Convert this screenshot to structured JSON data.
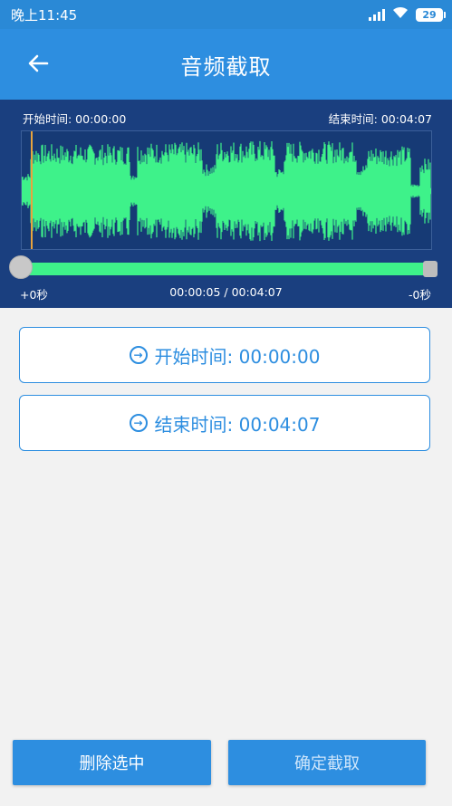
{
  "status_bar": {
    "time": "晚上11:45",
    "battery": "29",
    "icons": [
      "signal-icon",
      "wifi-icon",
      "battery-icon"
    ]
  },
  "app_bar": {
    "title": "音频截取",
    "back_icon": "arrow-left-icon"
  },
  "wave": {
    "start_label": "开始时间: 00:00:00",
    "end_label": "结束时间: 00:04:07",
    "plus_label": "+0秒",
    "progress_label": "00:00:05 / 00:04:07",
    "minus_label": "-0秒",
    "progress_fraction": 0.02,
    "colors": {
      "panel_bg": "#1a3f7f",
      "wave": "#3ef28a",
      "cursor": "#e8a33d"
    }
  },
  "buttons": {
    "start_time": {
      "label": "开始时间: 00:00:00",
      "icon": "arrow-circle-right-in-icon"
    },
    "end_time": {
      "label": "结束时间: 00:04:07",
      "icon": "arrow-circle-right-out-icon"
    },
    "delete": "删除选中",
    "confirm": "确定截取"
  },
  "colors": {
    "primary": "#2d8ee0",
    "background": "#f2f2f2"
  }
}
